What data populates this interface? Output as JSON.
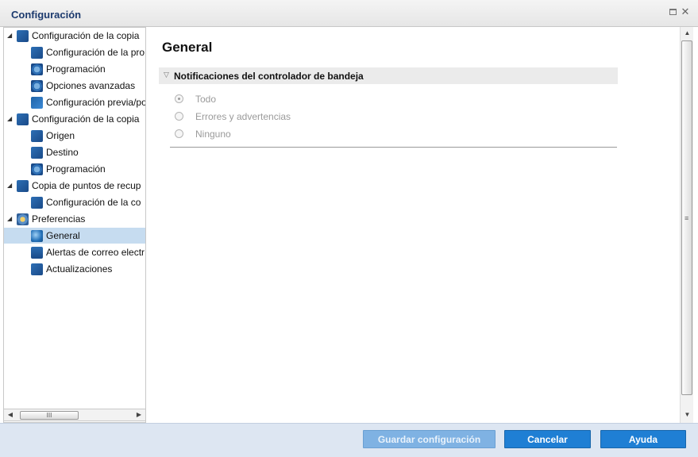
{
  "window": {
    "title": "Configuración",
    "restore_icon": "restore-icon",
    "close_icon": "close-icon",
    "close_glyph": "✕"
  },
  "tree": {
    "items": [
      {
        "label": "Configuración de la copia",
        "level": 0,
        "expanded": true,
        "icon": "backup-settings-icon"
      },
      {
        "label": "Configuración de la pro",
        "level": 1,
        "icon": "protection-settings-icon"
      },
      {
        "label": "Programación",
        "level": 1,
        "icon": "schedule-icon"
      },
      {
        "label": "Opciones avanzadas",
        "level": 1,
        "icon": "advanced-options-icon"
      },
      {
        "label": "Configuración previa/po",
        "level": 1,
        "icon": "wrench-icon"
      },
      {
        "label": "Configuración de la copia",
        "level": 0,
        "expanded": true,
        "icon": "file-copy-settings-icon"
      },
      {
        "label": "Origen",
        "level": 1,
        "icon": "source-icon"
      },
      {
        "label": "Destino",
        "level": 1,
        "icon": "destination-icon"
      },
      {
        "label": "Programación",
        "level": 1,
        "icon": "schedule-icon"
      },
      {
        "label": "Copia de puntos de recup",
        "level": 0,
        "expanded": true,
        "icon": "recovery-point-copy-icon"
      },
      {
        "label": "Configuración de la co",
        "level": 1,
        "icon": "copy-settings-icon"
      },
      {
        "label": "Preferencias",
        "level": 0,
        "expanded": true,
        "icon": "preferences-icon"
      },
      {
        "label": "General",
        "level": 1,
        "icon": "globe-icon",
        "selected": true
      },
      {
        "label": "Alertas de correo electr",
        "level": 1,
        "icon": "email-icon"
      },
      {
        "label": "Actualizaciones",
        "level": 1,
        "icon": "updates-icon"
      }
    ]
  },
  "hscroll": {
    "grip": "III",
    "left_arrow": "◀",
    "right_arrow": "▶"
  },
  "vscroll": {
    "grip": "≡",
    "up_arrow": "▲",
    "down_arrow": "▼"
  },
  "content": {
    "title": "General",
    "section": {
      "title": "Notificaciones del controlador de bandeja",
      "chevron_icon": "chevron-down-icon",
      "options": [
        {
          "label": "Todo",
          "checked": true,
          "disabled": true
        },
        {
          "label": "Errores y advertencias",
          "checked": false,
          "disabled": true
        },
        {
          "label": "Ninguno",
          "checked": false,
          "disabled": true
        }
      ]
    }
  },
  "footer": {
    "save_label": "Guardar configuración",
    "cancel_label": "Cancelar",
    "help_label": "Ayuda"
  },
  "colors": {
    "accent": "#1f7fd4",
    "title_text": "#1c3a6e",
    "selected_bg": "#c6dcf0",
    "footer_bg": "#dde6f2"
  }
}
